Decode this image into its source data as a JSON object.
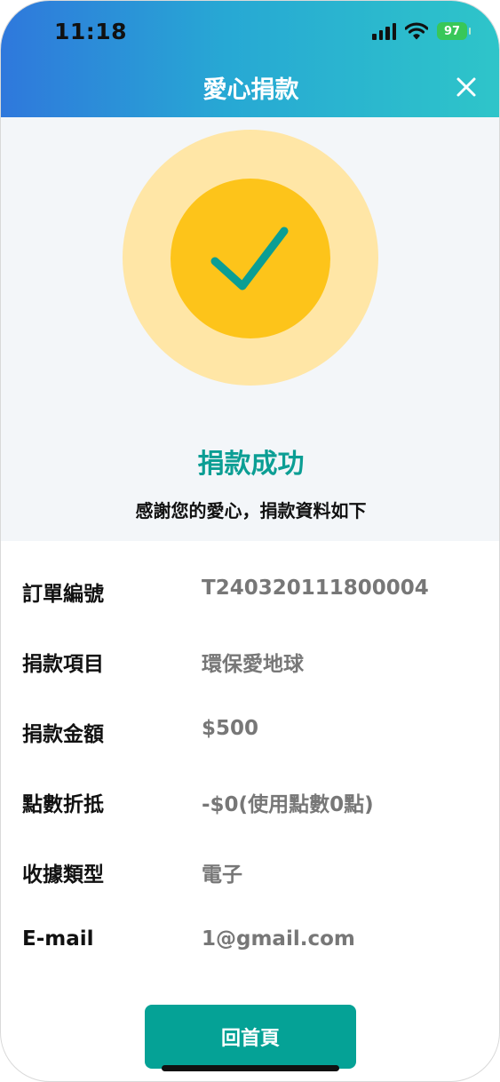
{
  "status_bar": {
    "time": "11:18",
    "battery": "97"
  },
  "header": {
    "title": "愛心捐款"
  },
  "result": {
    "title": "捐款成功",
    "subtitle": "感謝您的愛心，捐款資料如下"
  },
  "details": [
    {
      "label": "訂單編號",
      "value": "T240320111800004"
    },
    {
      "label": "捐款項目",
      "value": "環保愛地球"
    },
    {
      "label": "捐款金額",
      "value": "$500"
    },
    {
      "label": "點數折抵",
      "value": "-$0(使用點數0點)"
    },
    {
      "label": "收據類型",
      "value": "電子"
    },
    {
      "label": "E-mail",
      "value": "1@gmail.com"
    }
  ],
  "home_button": {
    "label": "回首頁"
  },
  "colors": {
    "accent": "#05a296",
    "check_outer": "#ffe6a6",
    "check_inner": "#fdc41a",
    "check_mark": "#0b9e94"
  },
  "icons": [
    "signal-icon",
    "wifi-icon",
    "battery-icon",
    "close-icon",
    "checkmark-icon"
  ]
}
